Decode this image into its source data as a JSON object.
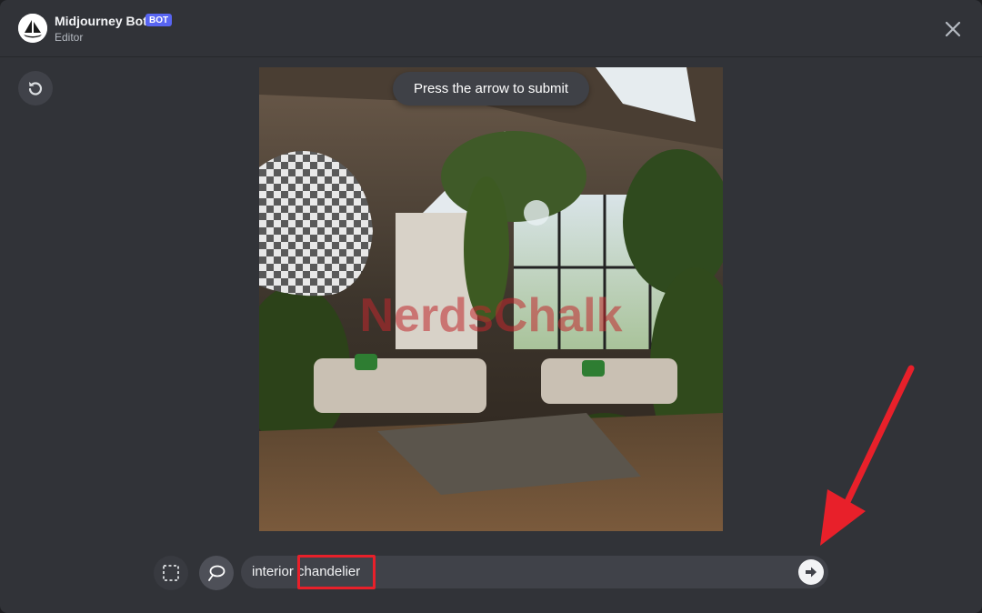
{
  "header": {
    "bot_name": "Midjourney Bot",
    "bot_badge": "BOT",
    "subtitle": "Editor",
    "close_icon": "close-icon",
    "avatar_icon": "sailboat-logo-icon"
  },
  "toolbar": {
    "undo_icon": "undo-icon",
    "rectangle_tool_icon": "rectangle-select-icon",
    "lasso_tool_icon": "lasso-icon",
    "active_tool": "lasso"
  },
  "tooltip": {
    "text": "Press the arrow to submit"
  },
  "canvas": {
    "image_description_icon": "image-canvas",
    "erased_region": "checkerboard-mask",
    "watermark_text": "NerdsChalk"
  },
  "prompt": {
    "value_part1": "interior",
    "value_part2": "chandelier",
    "submit_icon": "arrow-right-icon"
  },
  "colors": {
    "modal_bg": "#313338",
    "badge": "#5865f2",
    "highlight_box": "#e8202a",
    "annotation_arrow": "#e8202a"
  }
}
